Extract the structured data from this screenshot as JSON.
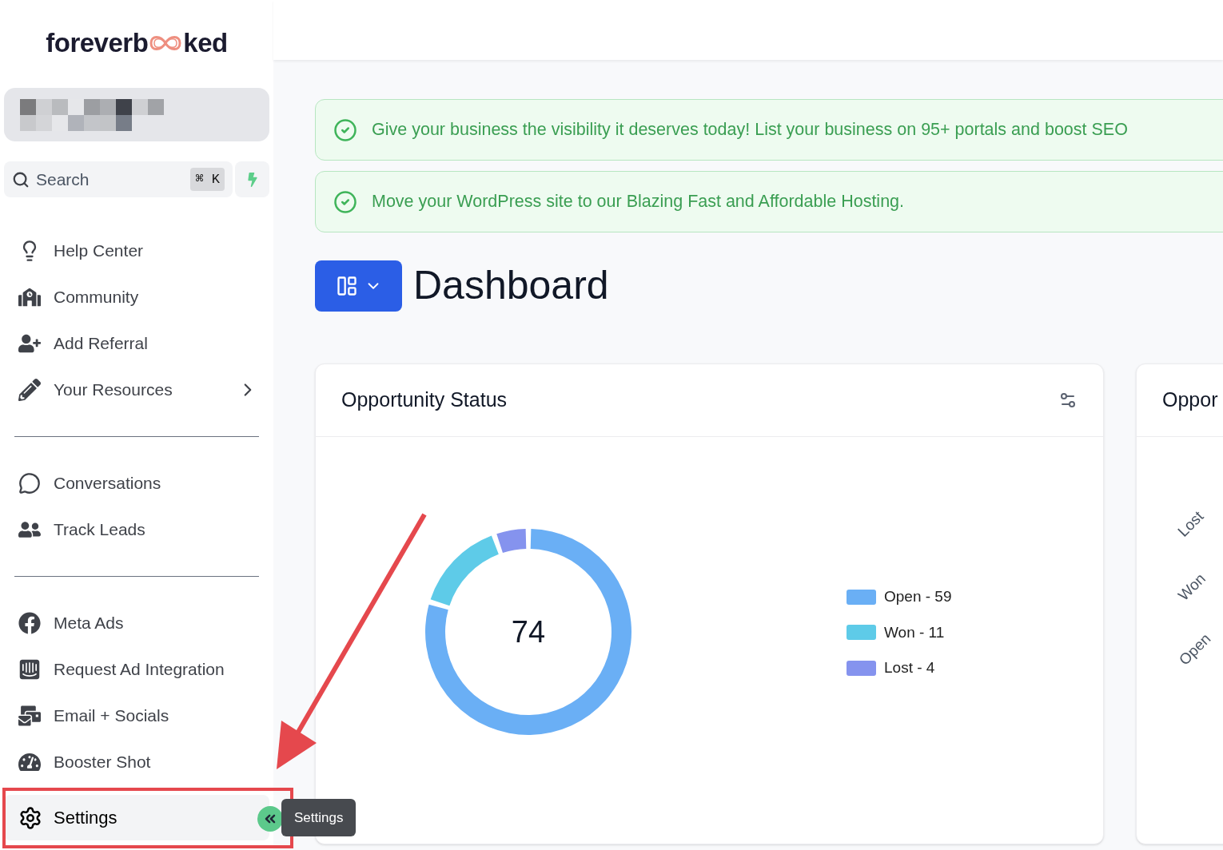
{
  "sidebar": {
    "logo": {
      "before": "foreverb",
      "after": "ked"
    },
    "search": {
      "placeholder": "Search",
      "shortcut": "⌘ K"
    },
    "sections": [
      [
        {
          "label": "Help Center",
          "has_submenu": false,
          "selected": false
        },
        {
          "label": "Community",
          "has_submenu": false,
          "selected": false
        },
        {
          "label": "Add Referral",
          "has_submenu": false,
          "selected": false
        },
        {
          "label": "Your Resources",
          "has_submenu": true,
          "selected": false
        }
      ],
      [
        {
          "label": "Conversations",
          "has_submenu": false,
          "selected": false
        },
        {
          "label": "Track Leads",
          "has_submenu": false,
          "selected": false
        }
      ],
      [
        {
          "label": "Meta Ads",
          "has_submenu": false,
          "selected": false
        },
        {
          "label": "Request Ad Integration",
          "has_submenu": false,
          "selected": false
        },
        {
          "label": "Email + Socials",
          "has_submenu": false,
          "selected": false
        },
        {
          "label": "Booster Shot",
          "has_submenu": false,
          "selected": false
        }
      ]
    ],
    "footer_item": {
      "label": "Settings",
      "selected": true
    },
    "tooltip": "Settings"
  },
  "banners": [
    "Give your business the visibility it deserves today! List your business on 95+ portals and boost SEO",
    "Move your WordPress site to our Blazing Fast and Affordable Hosting."
  ],
  "page_title": "Dashboard",
  "cards": [
    {
      "title": "Opportunity Status",
      "total": "74",
      "chart_data": {
        "type": "donut",
        "categories": [
          "Open - 59",
          "Won - 11",
          "Lost - 4"
        ],
        "values": [
          79.7,
          14.9,
          5.4
        ],
        "colors": [
          "#6aaff5",
          "#5ecbe8",
          "#8593ee"
        ]
      }
    },
    {
      "title": "Oppor",
      "axis_labels": [
        "Lost",
        "Won",
        "Open"
      ]
    }
  ]
}
